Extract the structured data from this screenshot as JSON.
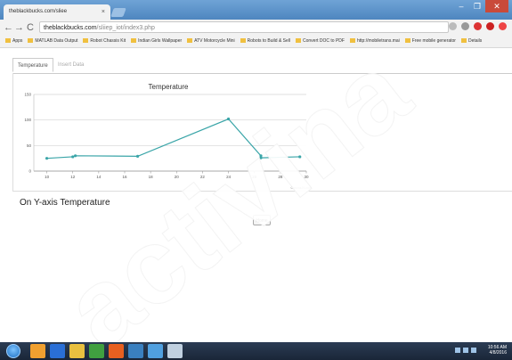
{
  "browser": {
    "tab_title": "theblackbucks.com/sliee",
    "tab_close": "×",
    "url_host": "theblackbucks.com",
    "url_path": "/sliiep_iot/index3.php",
    "back": "←",
    "forward": "→",
    "reload": "C",
    "window_controls": [
      "–",
      "❐",
      "✕"
    ]
  },
  "bookmarks": [
    "Apps",
    "MATLAB Data Output",
    "Robot Chassis Kit",
    "Indian Girls Wallpaper",
    "ATV Motorcycle Mini",
    "Robots to Build & Sell",
    "Convert DOC to PDF",
    "http://mobiletrans.mai",
    "Free mobile generator",
    "Details"
  ],
  "page": {
    "tabs": [
      {
        "label": "Temperature",
        "active": true
      },
      {
        "label": "Insert Data",
        "active": false
      }
    ],
    "caption": "On Y-axis Temperature",
    "home_button": "Home"
  },
  "chart_data": {
    "type": "line",
    "title": "Temperature",
    "xlabel": "",
    "ylabel": "",
    "credit": "CanvasJS.com",
    "ylim": [
      0,
      150
    ],
    "yticks": [
      "0",
      "50",
      "100",
      "150"
    ],
    "xlim": [
      9,
      30
    ],
    "xticks": [
      "10",
      "12",
      "14",
      "16",
      "18",
      "20",
      "22",
      "24",
      "26",
      "28",
      "30"
    ],
    "grid": true,
    "color": "#3aa5a8",
    "series": [
      {
        "points": [
          {
            "x": 10,
            "y": 25
          },
          {
            "x": 12,
            "y": 28
          },
          {
            "x": 12.2,
            "y": 30
          },
          {
            "x": 17,
            "y": 29
          },
          {
            "x": 24,
            "y": 102
          },
          {
            "x": 26.5,
            "y": 30
          },
          {
            "x": 26.5,
            "y": 26
          },
          {
            "x": 29.5,
            "y": 28
          }
        ]
      }
    ]
  },
  "taskbar": {
    "clock_time": "10:56 AM",
    "clock_date": "4/8/2016",
    "apps": [
      "#f0a030",
      "#2a6fd6",
      "#e8c040",
      "#40a040",
      "#e86020",
      "#3a80c0",
      "#50a0e0",
      "#c0d0e0"
    ]
  },
  "watermark": "activina"
}
